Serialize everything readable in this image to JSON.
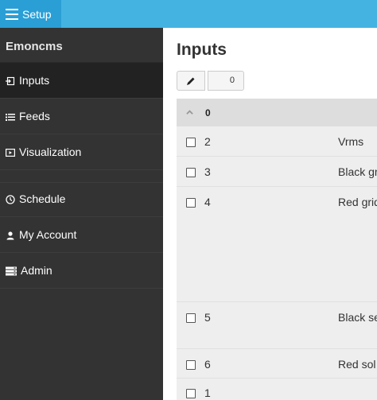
{
  "topbar": {
    "setup_label": "Setup"
  },
  "sidebar": {
    "brand": "Emoncms",
    "items": [
      {
        "label": "Inputs",
        "icon": "input-icon",
        "active": true
      },
      {
        "label": "Feeds",
        "icon": "list-icon"
      },
      {
        "label": "Visualization",
        "icon": "visualization-icon"
      },
      {
        "label": "Schedule",
        "icon": "clock-icon"
      },
      {
        "label": "My Account",
        "icon": "user-icon"
      },
      {
        "label": "Admin",
        "icon": "server-icon"
      }
    ]
  },
  "main": {
    "title": "Inputs",
    "selected_count": "0",
    "group": {
      "name": "0"
    },
    "rows": [
      {
        "id": "2",
        "desc": "Vrms"
      },
      {
        "id": "3",
        "desc": "Black gr"
      },
      {
        "id": "4",
        "desc": "Red grid"
      },
      {
        "id": "5",
        "desc": "Black se"
      },
      {
        "id": "6",
        "desc": "Red sol"
      },
      {
        "id": "1",
        "desc": ""
      }
    ]
  },
  "colors": {
    "topbar": "#44b3e2",
    "setup_button": "#2a9fd6",
    "sidebar": "#333333",
    "sidebar_active": "#222222",
    "group_header": "#dddddd",
    "row_bg": "#eeeeee"
  }
}
